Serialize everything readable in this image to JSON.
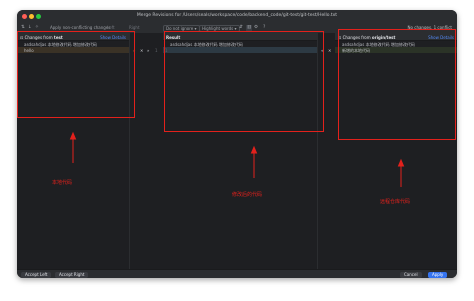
{
  "window": {
    "title": "Merge Revisions for /Users/seals/workspace/code/backend_code/git-test/git-test/Hello.txt"
  },
  "toolbar": {
    "apply_non_conflicting": "Apply non-conflicting changes",
    "left": "Left",
    "right": "Right",
    "ignore_option": "Do not ignore",
    "highlight_option": "Highlight words",
    "help": "?",
    "status": "No changes. 1 conflict"
  },
  "panes": {
    "left": {
      "header_prefix": "Changes from",
      "header_branch": "test",
      "show_details": "Show Details",
      "lines": [
        "asdsahdjas 本地修改代码  增加修改代码",
        "hello"
      ]
    },
    "middle": {
      "header": "Result",
      "lines": [
        "asdsahdjas 本地修改代码  增加修改代码",
        ""
      ]
    },
    "right": {
      "header_prefix": "Changes from",
      "header_branch": "origin/test",
      "show_details": "Show Details",
      "lines": [
        "asdsahdjas 本地修改代码  增加修改代码",
        "新增的本地代码"
      ]
    }
  },
  "gutter": {
    "reject": "✕",
    "accept": "»",
    "accept_right": "«",
    "line_num": "1"
  },
  "footer": {
    "accept_left": "Accept Left",
    "accept_right": "Accept Right",
    "cancel": "Cancel",
    "apply": "Apply"
  },
  "annotations": {
    "local": "本地代码",
    "result": "修改后的代码",
    "remote": "远程仓库代码"
  },
  "colors": {
    "annotation": "#e3211c",
    "accent": "#3574f0"
  }
}
